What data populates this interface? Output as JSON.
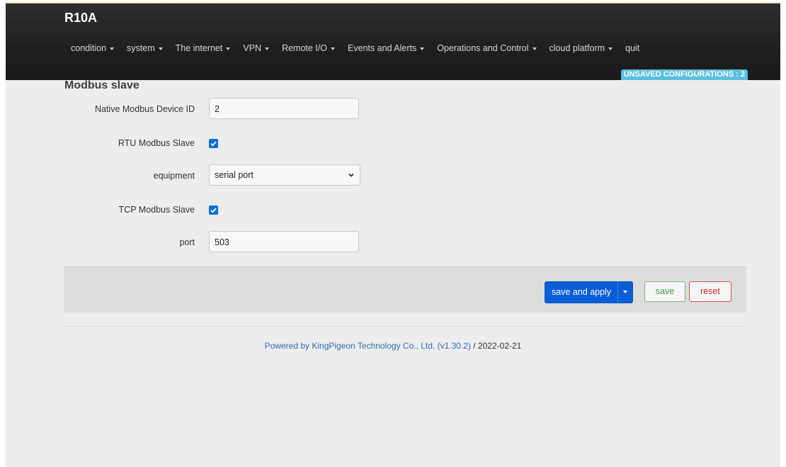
{
  "header": {
    "brand": "R10A",
    "nav": [
      {
        "label": "condition",
        "dropdown": true
      },
      {
        "label": "system",
        "dropdown": true
      },
      {
        "label": "The internet",
        "dropdown": true
      },
      {
        "label": "VPN",
        "dropdown": true
      },
      {
        "label": "Remote I/O",
        "dropdown": true
      },
      {
        "label": "Events and Alerts",
        "dropdown": true
      },
      {
        "label": "Operations and Control",
        "dropdown": true
      },
      {
        "label": "cloud platform",
        "dropdown": true
      },
      {
        "label": "quit",
        "dropdown": false
      }
    ],
    "unsaved_badge": "UNSAVED CONFIGURATIONS : 2"
  },
  "section": {
    "title": "Modbus slave"
  },
  "form": {
    "device_id_label": "Native Modbus Device ID",
    "device_id_value": "2",
    "rtu_label": "RTU Modbus Slave",
    "rtu_checked": true,
    "equipment_label": "equipment",
    "equipment_value": "serial port",
    "tcp_label": "TCP Modbus Slave",
    "tcp_checked": true,
    "port_label": "port",
    "port_value": "503"
  },
  "actions": {
    "save_apply": "save and apply",
    "save": "save",
    "reset": "reset"
  },
  "footer": {
    "link_text": "Powered by KingPigeon Technology Co., Ltd. (v1.30.2)",
    "suffix": " / 2022-02-21"
  },
  "colors": {
    "primary": "#0b5ed7",
    "badge": "#5bc0de",
    "save": "#4a9d4e",
    "reset": "#c9302c"
  }
}
